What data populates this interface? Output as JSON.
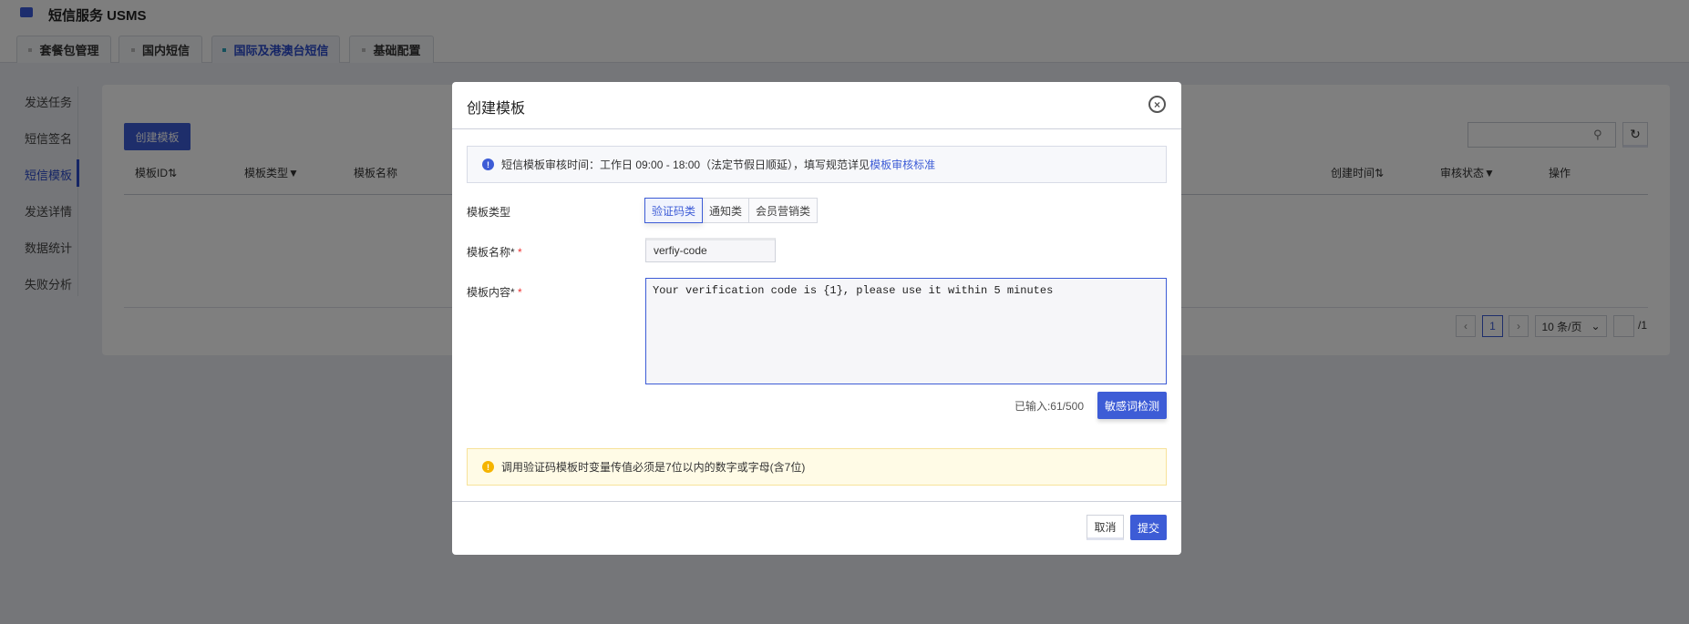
{
  "app": {
    "title": "短信服务 USMS"
  },
  "tabs": [
    {
      "label": "套餐包管理"
    },
    {
      "label": "国内短信"
    },
    {
      "label": "国际及港澳台短信",
      "active": true
    },
    {
      "label": "基础配置"
    }
  ],
  "sidebar": {
    "items": [
      {
        "label": "发送任务"
      },
      {
        "label": "短信签名"
      },
      {
        "label": "短信模板",
        "active": true
      },
      {
        "label": "发送详情"
      },
      {
        "label": "数据统计"
      },
      {
        "label": "失败分析"
      }
    ]
  },
  "main": {
    "create_button": "创建模板",
    "search": {
      "placeholder": ""
    },
    "columns": [
      "模板ID⇅",
      "模板类型▼",
      "模板名称",
      "创建时间⇅",
      "审核状态▼",
      "操作"
    ],
    "pagination": {
      "current": "1",
      "page_size": "10 条/页",
      "jump_value": "",
      "total_pages": "/1"
    }
  },
  "modal": {
    "title": "创建模板",
    "info_text": "短信模板审核时间：工作日 09:00 - 18:00（法定节假日顺延），填写规范详见",
    "info_link": "模板审核标准",
    "type_label": "模板类型",
    "type_options": [
      "验证码类",
      "通知类",
      "会员营销类"
    ],
    "name_label": "模板名称*",
    "name_value": "verfiy-code",
    "content_label": "模板内容*",
    "content_value": "Your verification code is {1}, please use it within 5 minutes",
    "counter": "已输入:61/500",
    "check_button": "敏感词检测",
    "warning_text": "调用验证码模板时变量传值必须是7位以内的数字或字母(含7位)",
    "cancel": "取消",
    "submit": "提交"
  },
  "colors": {
    "primary": "#3d5cd6",
    "warning": "#f5b400"
  }
}
